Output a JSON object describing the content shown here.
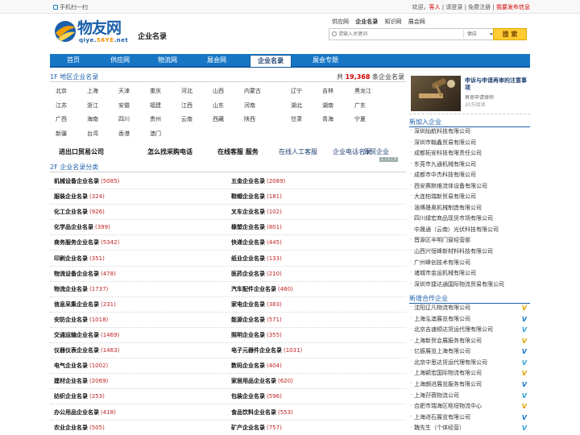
{
  "topbar": {
    "scan": "手机扫一扫",
    "welcome": "欢迎，",
    "guest": "客人",
    "sep1": "|",
    "login": "请登录",
    "sep2": "|",
    "register": "免费注册",
    "sep3": "|",
    "publish": "我要发布信息"
  },
  "logo": {
    "name": "物友网",
    "sub_a": "qiye.",
    "sub_b": "56YE",
    "sub_c": ".net"
  },
  "site_title": "企业名录",
  "search": {
    "tabs": [
      "供应网",
      "企业名录",
      "知识网",
      "展会网"
    ],
    "placeholder": "请输入关键词",
    "select": "供应",
    "button": "搜 索"
  },
  "nav": [
    "首页",
    "供应网",
    "物流网",
    "展会网",
    "企业名录",
    "展会专题"
  ],
  "colors": {
    "accent": "#1877c5",
    "highlight": "#d40000",
    "button": "#ffcc33"
  },
  "region": {
    "title": "1F 地区企业名录",
    "count_pre": "共",
    "count": "19,368",
    "count_post": "条企业名录",
    "rows": [
      [
        "北京",
        "上海",
        "天津",
        "重庆",
        "河北",
        "山西",
        "内蒙古",
        "辽宁",
        "吉林",
        "黑龙江"
      ],
      [
        "江苏",
        "浙江",
        "安徽",
        "福建",
        "江西",
        "山东",
        "河南",
        "湖北",
        "湖南",
        "广东"
      ],
      [
        "广西",
        "海南",
        "四川",
        "贵州",
        "云南",
        "西藏",
        "陕西",
        "甘肃",
        "青海",
        "宁夏"
      ],
      [
        "新疆",
        "台湾",
        "香港",
        "澳门"
      ]
    ]
  },
  "quick_links": [
    "进出口贸易公司",
    "怎么找采购电话",
    "在线客服 服务",
    "在线人工客服",
    "企业电话名录",
    "外贸企业"
  ],
  "mini_tag": "1 | 2 | 3",
  "categories": {
    "title": "2F 企业名录分类",
    "items": [
      {
        "name": "机械设备企业名录",
        "count": "(5085)"
      },
      {
        "name": "五金企业名录",
        "count": "(2089)"
      },
      {
        "name": "服装企业名录",
        "count": "(324)"
      },
      {
        "name": "鞋帽企业名录",
        "count": "(181)"
      },
      {
        "name": "化工企业名录",
        "count": "(926)"
      },
      {
        "name": "叉车企业名录",
        "count": "(102)"
      },
      {
        "name": "化学品企业名录",
        "count": "(399)"
      },
      {
        "name": "橡塑企业名录",
        "count": "(801)"
      },
      {
        "name": "商务服务企业名录",
        "count": "(5342)"
      },
      {
        "name": "快递企业名录",
        "count": "(445)"
      },
      {
        "name": "印刷企业名录",
        "count": "(351)"
      },
      {
        "name": "纸业企业名录",
        "count": "(133)"
      },
      {
        "name": "物流设备企业名录",
        "count": "(478)"
      },
      {
        "name": "医药企业名录",
        "count": "(210)"
      },
      {
        "name": "物流企业名录",
        "count": "(1737)"
      },
      {
        "name": "汽车配件企业名录",
        "count": "(460)"
      },
      {
        "name": "信息采集企业名录",
        "count": "(231)"
      },
      {
        "name": "家电企业名录",
        "count": "(383)"
      },
      {
        "name": "安防企业名录",
        "count": "(1018)"
      },
      {
        "name": "能源企业名录",
        "count": "(571)"
      },
      {
        "name": "交通运输企业名录",
        "count": "(1469)"
      },
      {
        "name": "照明企业名录",
        "count": "(355)"
      },
      {
        "name": "仪器仪表企业名录",
        "count": "(1463)"
      },
      {
        "name": "电子元器件企业名录",
        "count": "(1031)"
      },
      {
        "name": "电气企业名录",
        "count": "(1002)"
      },
      {
        "name": "数码企业名录",
        "count": "(404)"
      },
      {
        "name": "建材企业名录",
        "count": "(2069)"
      },
      {
        "name": "家居用品企业名录",
        "count": "(620)"
      },
      {
        "name": "纺织企业名录",
        "count": "(253)"
      },
      {
        "name": "包装企业名录",
        "count": "(596)"
      },
      {
        "name": "办公用品企业名录",
        "count": "(418)"
      },
      {
        "name": "食品饮料企业名录",
        "count": "(553)"
      },
      {
        "name": "农业企业名录",
        "count": "(505)"
      },
      {
        "name": "矿产企业名录",
        "count": "(757)"
      }
    ]
  },
  "news": {
    "title": "申诉与申请再审的注意事项",
    "author": "再审申请律师",
    "views": "20万阅读"
  },
  "new_companies": {
    "title": "新加入企业",
    "items": [
      "深圳灿航科技有限公司",
      "深圳市翰鑫贸易有限公司",
      "成都拓安科技有限责任公司",
      "东莞市九通机械有限公司",
      "成都市中杰科技有限公司",
      "西安赛默维流体设备有限公司",
      "大连柏瑞新贸易有限公司",
      "淄博晟奥机械制造有限公司",
      "四川绿宏商品现货市场有限公司",
      "中晟通（云南）光伏科技有限公司",
      "晋源区丰明门窗经营部",
      "山西兴恒峰新材料科技有限公司",
      "广州峰创技术有限公司",
      "诸城市金运机械有限公司",
      "深圳市捷达通国际物流贸易有限公司"
    ]
  },
  "new_partners": {
    "title": "新增合作企业",
    "items": [
      "沈阳辽凡物流有限公司",
      "上海泓澳展览有限公司",
      "北京吉速顺达货运代理有限公司",
      "上海新贸会展服务有限公司",
      "亿振展览上海有限公司",
      "北京中思达货运代理有限公司",
      "上海颖宏国际物流有限公司",
      "上海朗进展览服务有限公司",
      "上海孖薇物流公司",
      "合肥市瑞海区枢纽物流中心",
      "上海进石展览有限公司",
      "魏先生（个体经营）"
    ],
    "badge": "V"
  }
}
